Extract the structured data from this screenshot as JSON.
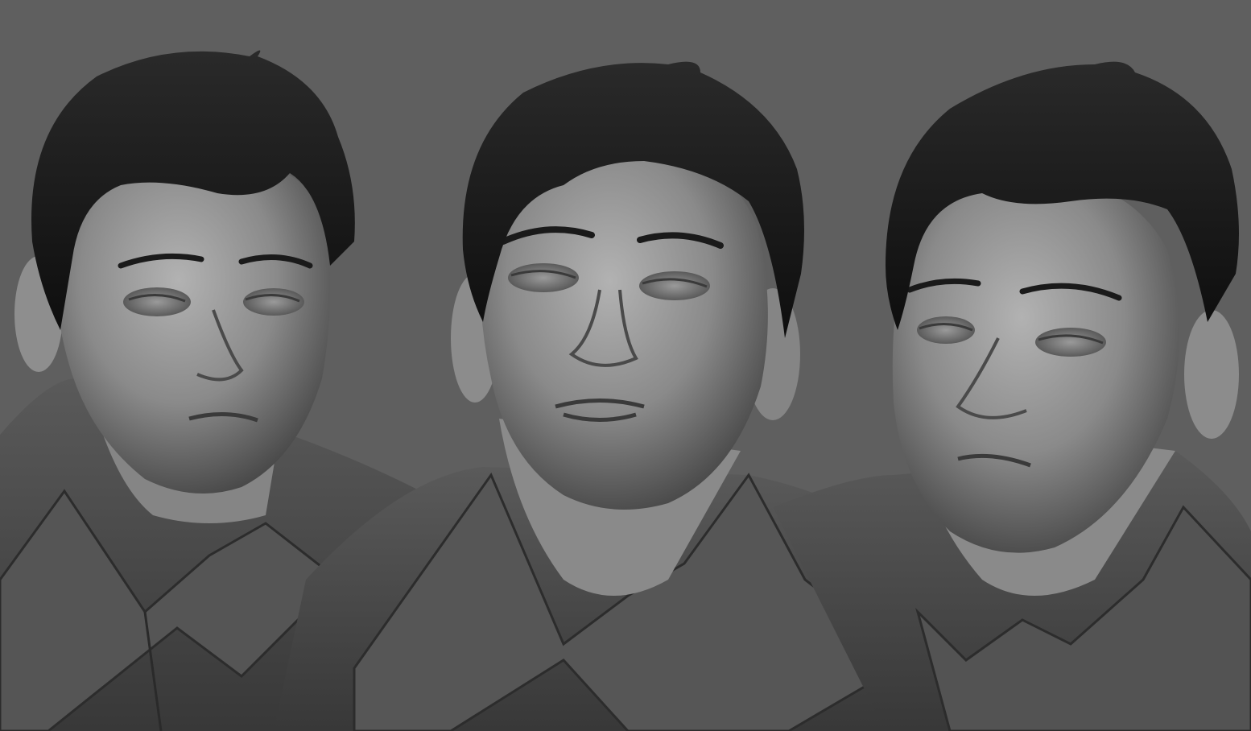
{
  "scene": {
    "background_color": "#5f5f5f",
    "material": "clay-matcap-gray",
    "views": [
      {
        "view": "three-quarter-left"
      },
      {
        "view": "front"
      },
      {
        "view": "three-quarter-right"
      }
    ]
  },
  "colors": {
    "background": "#5f5f5f",
    "skin_light": "#a9a9a9",
    "skin_mid": "#7e7e7e",
    "skin_dark": "#444444",
    "hair": "#151515",
    "shirt": "#4a4a4a",
    "shirt_dark": "#303030",
    "shirt_light": "#6a6a6a"
  }
}
